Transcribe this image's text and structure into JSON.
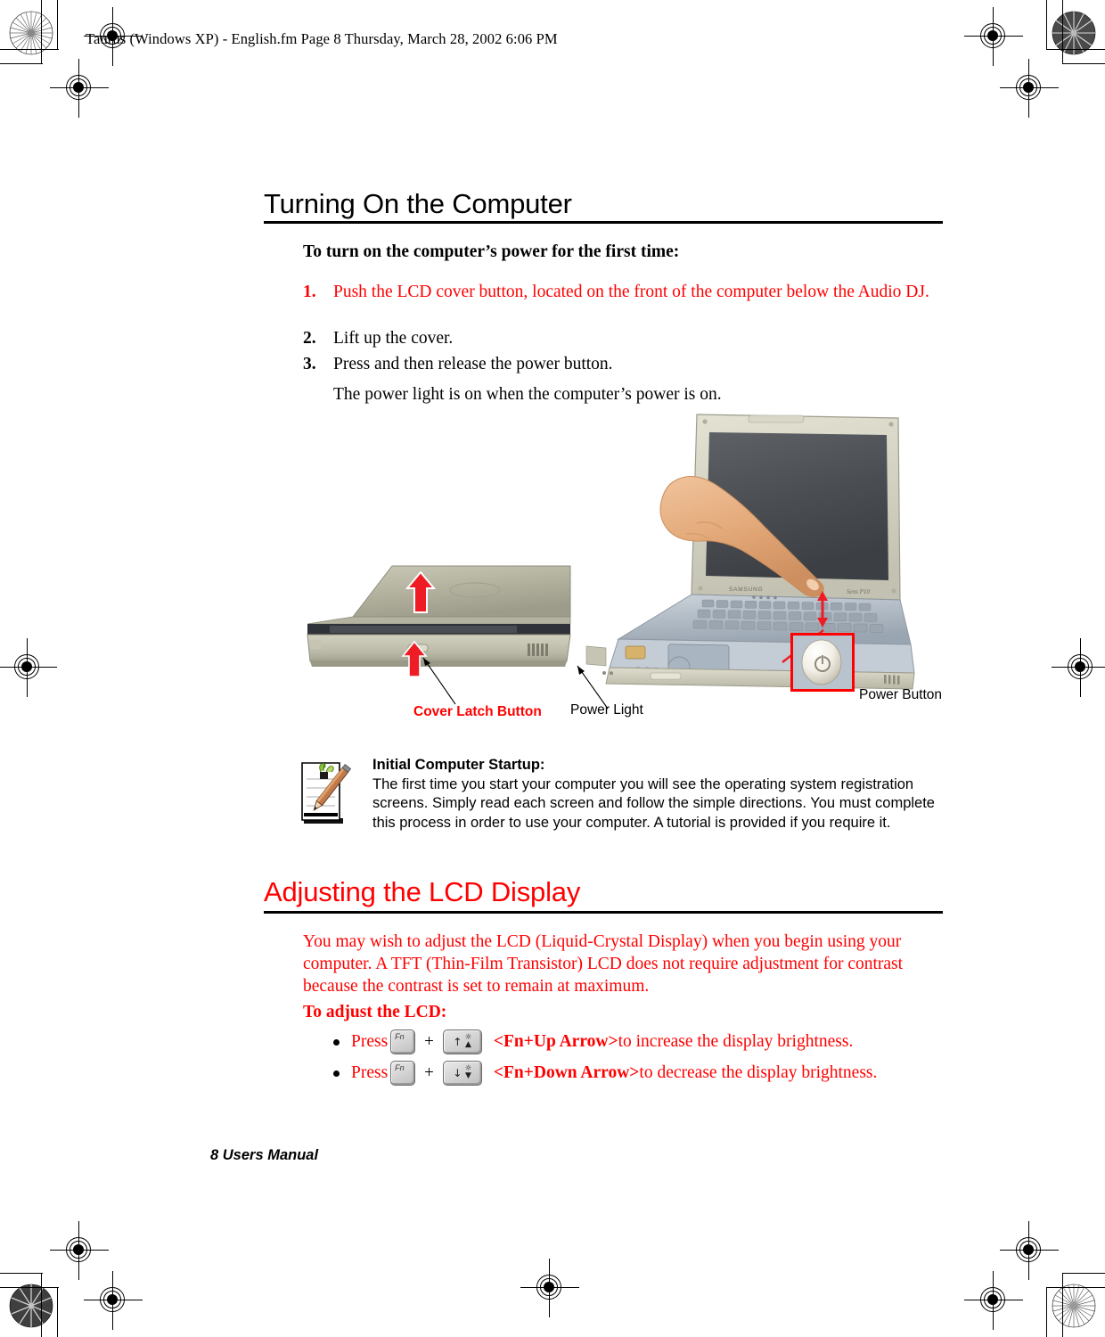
{
  "page": {
    "file_header": "Taurus (Windows XP) - English.fm  Page 8  Thursday, March 28, 2002  6:06 PM",
    "footer": "8  Users Manual",
    "page_number": "8",
    "manual_name": "Users Manual"
  },
  "colors": {
    "accent_red": "#ff0000",
    "text_black": "#000000",
    "rule_black": "#000000",
    "key_grey": "#d2d2d2"
  },
  "section_turning_on": {
    "heading": "Turning On the Computer",
    "lead_in": "To turn on the computer’s power for the first time:",
    "steps": [
      {
        "number": "1.",
        "text": "Push the LCD cover button, located on the front of the computer below the Audio DJ.",
        "color": "#ff0000"
      },
      {
        "number": "2.",
        "text": "Lift up the cover.",
        "color": "#000000"
      },
      {
        "number": "3.",
        "text": "Press and then release the power button.",
        "color": "#000000"
      }
    ],
    "follow_up": "The power light is on when the computer’s power is on."
  },
  "figure": {
    "labels": [
      {
        "text": "Cover Latch Button",
        "color": "#ff0000"
      },
      {
        "text": "Power Light",
        "color": "#000000"
      },
      {
        "text": "Power Button",
        "color": "#000000"
      }
    ],
    "closed_laptop_alt": "closed-laptop-photo",
    "open_laptop_alt": "open-laptop-photo-with-hand",
    "power_button_inset_alt": "power-button-closeup"
  },
  "note": {
    "icon": "notepad-pencil-icon",
    "title": "Initial Computer Startup:",
    "body": "The first time you start your computer you will see the operating system registration screens. Simply read each screen and follow the simple directions. You must complete this process in order to use your computer. A tutorial is provided if you require it."
  },
  "section_lcd": {
    "heading": "Adjusting the LCD Display",
    "paragraph": "You may wish to adjust the LCD (Liquid-Crystal Display) when you begin using your computer. A TFT (Thin-Film Transistor) LCD does not require adjustment for contrast because the contrast is set to remain at maximum.",
    "lead_in": "To adjust the LCD:",
    "bullets": [
      {
        "press_label": "Press",
        "key1": "Fn",
        "plus": "+",
        "key2_glyph": "↑",
        "key2_name": "up-arrow-brightness-key",
        "shortcut": "<Fn+Up Arrow>",
        "description": " to increase the display brightness."
      },
      {
        "press_label": "Press",
        "key1": "Fn",
        "plus": "+",
        "key2_glyph": "↓",
        "key2_name": "down-arrow-brightness-key",
        "shortcut": "<Fn+Down Arrow>",
        "description": " to decrease the display brightness."
      }
    ]
  },
  "printer_marks": {
    "rosette_count": "4",
    "registration_count": "8",
    "description": "print registration targets and crop marks"
  }
}
